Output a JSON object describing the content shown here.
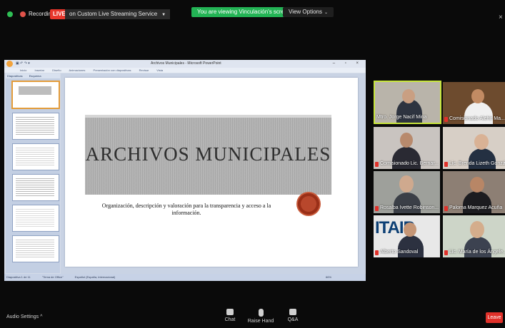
{
  "top_bar": {
    "recording_label": "Recording",
    "live_badge": "LIVE",
    "live_service": "on Custom Live Streaming Service",
    "viewing_banner": "You are viewing Vinculación's screen",
    "view_options": "View Options",
    "close_symbol": "×"
  },
  "ppt": {
    "title": "Archivos Municipales - Microsoft PowerPoint",
    "quick_access": "▣ ↶ ↷ ▾",
    "window_controls": "– ▫ ×",
    "ribbon_tabs": [
      "Inicio",
      "Insertar",
      "Diseño",
      "Animaciones",
      "Presentación con diapositivas",
      "Revisar",
      "Vista"
    ],
    "thumb_tabs": [
      "Diapositivas",
      "Esquema"
    ],
    "status": [
      "Diapositiva 1 de 11",
      "\"Tema de Office\"",
      "Español (España, internacional)"
    ],
    "zoom": "66%"
  },
  "slide": {
    "title": "ARCHIVOS MUNICIPALES",
    "subtitle": "Organización, descripción y valoración para la transparencia y acceso a la información."
  },
  "participants": [
    {
      "name": "Mtro. Jorge Nacif Mina"
    },
    {
      "name": "Comisionado Alehir Ma..."
    },
    {
      "name": "Comisionado Lic. Bernar..."
    },
    {
      "name": "Lic. Brenda Lizeth Gonzá..."
    },
    {
      "name": "Rosalba Ivette Robinson..."
    },
    {
      "name": "Paloma Marquez Acuña"
    },
    {
      "name": "Alberto Sandoval"
    },
    {
      "name": "Lic. María de los Ángele..."
    }
  ],
  "itaip_logo": "ITAIP",
  "toolbar": {
    "audio_settings": "Audio Settings ^",
    "chat": "Chat",
    "raise_hand": "Raise Hand",
    "qa": "Q&A",
    "leave": "Leave"
  },
  "colors": {
    "live": "#e9372c",
    "viewing": "#23b455",
    "leave": "#e0312a",
    "active_speaker": "#c8e63c"
  }
}
